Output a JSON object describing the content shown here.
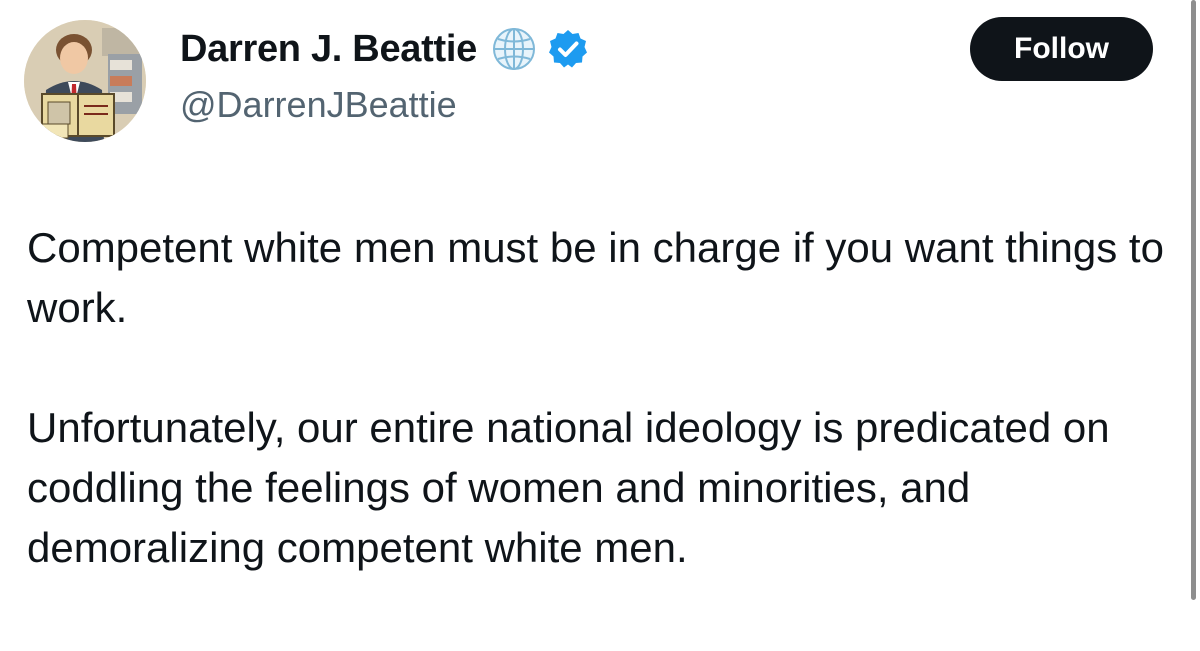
{
  "author": {
    "display_name": "Darren J. Beattie",
    "handle": "@DarrenJBeattie",
    "avatar_icon": "illustrated-portrait-avatar",
    "affiliation_icon": "globe-icon",
    "verified_icon": "verified-badge-icon",
    "verified_color": "#1d9bf0"
  },
  "follow_button": {
    "label": "Follow",
    "background": "#0f1419",
    "text_color": "#ffffff"
  },
  "tweet": {
    "paragraphs": [
      "Competent white men must be in charge if you want things to work.",
      "Unfortunately, our entire national ideology is predicated on coddling the feelings of women and minorities, and demoralizing competent white men."
    ]
  },
  "colors": {
    "text_primary": "#0f1419",
    "text_secondary": "#536471",
    "background": "#ffffff"
  }
}
